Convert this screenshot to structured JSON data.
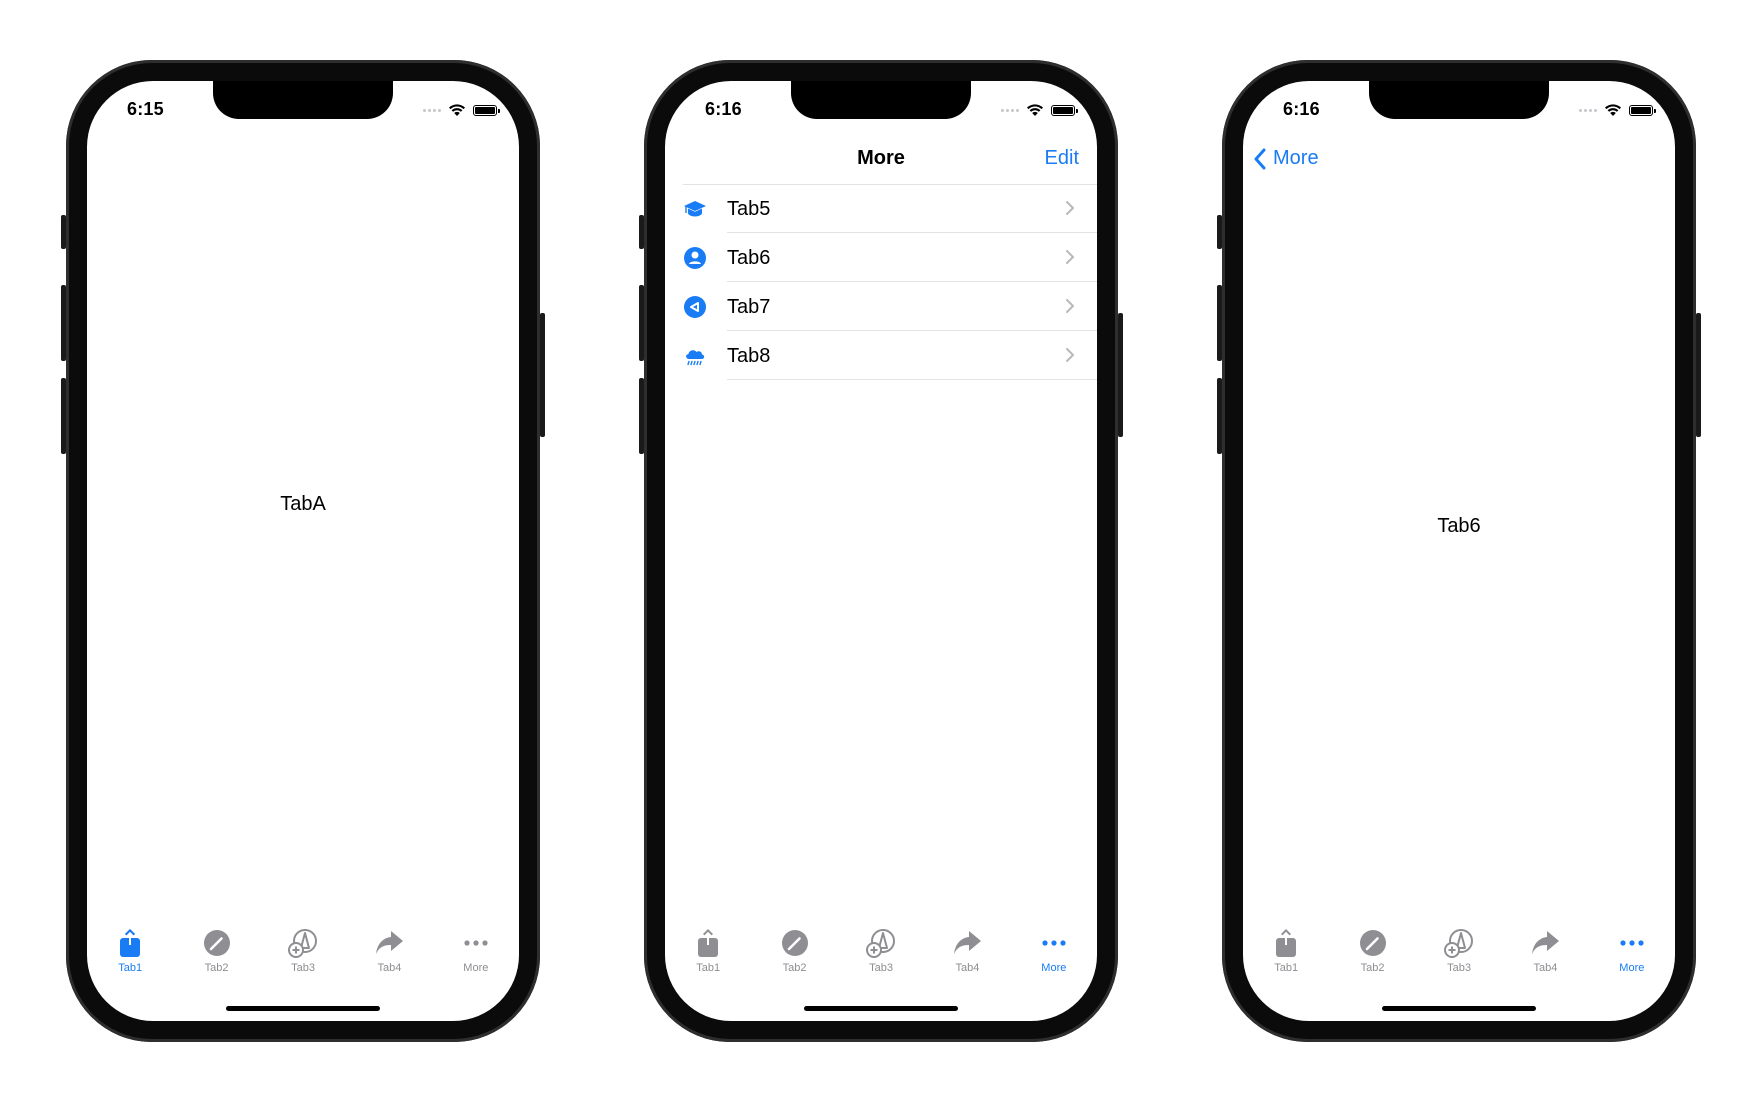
{
  "colors": {
    "accent": "#1a7cf5",
    "inactive": "#8e8e93",
    "frame": "#0b0b0b"
  },
  "phones": [
    {
      "status": {
        "time": "6:15"
      },
      "content": {
        "label": "TabA"
      },
      "tabbar": {
        "active": 0,
        "tabs": [
          {
            "label": "Tab1",
            "icon": "share-icon"
          },
          {
            "label": "Tab2",
            "icon": "pencil-circle-icon"
          },
          {
            "label": "Tab3",
            "icon": "highlighter-plus-icon"
          },
          {
            "label": "Tab4",
            "icon": "arrowshape-forward-icon"
          },
          {
            "label": "More",
            "icon": "ellipsis-icon"
          }
        ]
      }
    },
    {
      "status": {
        "time": "6:16"
      },
      "nav": {
        "title": "More",
        "edit_label": "Edit"
      },
      "more_list": [
        {
          "label": "Tab5",
          "icon": "graduation-cap-icon"
        },
        {
          "label": "Tab6",
          "icon": "person-circle-icon"
        },
        {
          "label": "Tab7",
          "icon": "arrow-left-circle-icon"
        },
        {
          "label": "Tab8",
          "icon": "cloud-rain-icon"
        }
      ],
      "tabbar": {
        "active": 4,
        "tabs": [
          {
            "label": "Tab1",
            "icon": "share-icon"
          },
          {
            "label": "Tab2",
            "icon": "pencil-circle-icon"
          },
          {
            "label": "Tab3",
            "icon": "highlighter-plus-icon"
          },
          {
            "label": "Tab4",
            "icon": "arrowshape-forward-icon"
          },
          {
            "label": "More",
            "icon": "ellipsis-icon"
          }
        ]
      }
    },
    {
      "status": {
        "time": "6:16"
      },
      "nav": {
        "back_label": "More"
      },
      "content": {
        "label": "Tab6"
      },
      "tabbar": {
        "active": 4,
        "tabs": [
          {
            "label": "Tab1",
            "icon": "share-icon"
          },
          {
            "label": "Tab2",
            "icon": "pencil-circle-icon"
          },
          {
            "label": "Tab3",
            "icon": "highlighter-plus-icon"
          },
          {
            "label": "Tab4",
            "icon": "arrowshape-forward-icon"
          },
          {
            "label": "More",
            "icon": "ellipsis-icon"
          }
        ]
      }
    }
  ]
}
